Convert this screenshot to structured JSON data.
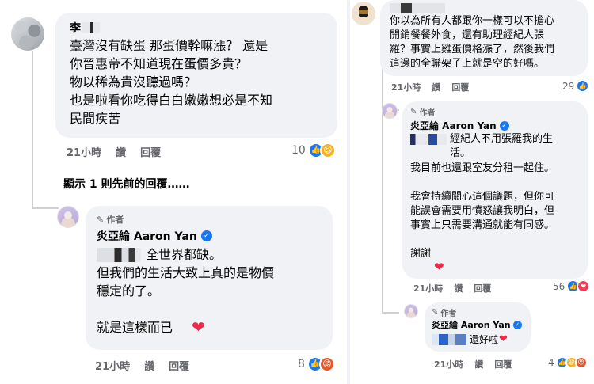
{
  "left": {
    "comment1": {
      "author_initial": "李",
      "text": "臺灣沒有缺蛋 那蛋價幹嘛漲？ 還是\n你晉惠帝不知道現在蛋價多貴？\n物以稀為貴沒聽過嗎？\n也是啦看你吃得白白嫩嫩想必是不知\n民間疾苦",
      "time": "21小時",
      "like": "讚",
      "reply": "回覆",
      "reaction_count": "10"
    },
    "show_previous": "顯示 1 則先前的回覆……",
    "reply1": {
      "author_badge": "作者",
      "author_name": "炎亞綸 Aaron Yan",
      "tagged_tail": "全世界都缺。",
      "text": "但我們的生活大致上真的是物價\n穩定的了。\n\n就是這樣而已",
      "time": "21小時",
      "like": "讚",
      "reply": "回覆",
      "reaction_count": "8"
    }
  },
  "right": {
    "comment1": {
      "text": "你以為所有人都跟你一樣可以不擔心\n開銷餐餐外食，還有助理經紀人張\n羅？事實上雞蛋價格漲了，然後我們\n這邊的全聯架子上就是空的好嗎。",
      "time": "21小時",
      "like": "讚",
      "reply": "回覆",
      "reaction_count": "29"
    },
    "reply1": {
      "author_badge": "作者",
      "author_name": "炎亞綸 Aaron Yan",
      "tagged_tail": "經紀人不用張羅我的生\n活。",
      "text": "我目前也還跟室友分租一起住。\n\n我會持續關心這個議題，但你可\n能誤會需要用憤怒讓我明白，但\n事實上只需要溝通就能有同感。\n\n謝謝",
      "time": "21小時",
      "like": "讚",
      "reply": "回覆",
      "reaction_count": "56"
    },
    "reply2": {
      "author_badge": "作者",
      "author_name": "炎亞綸 Aaron Yan",
      "text": "還好啦",
      "time": "21小時",
      "like": "讚",
      "reply": "回覆",
      "reaction_count": "4"
    }
  },
  "icons": {
    "verified": "verified-check-icon",
    "pen": "pen-icon",
    "heart": "heart-emoji-icon"
  },
  "colors": {
    "bubble": "#f0f2f5",
    "meta": "#65676b",
    "like_blue": "#1877f2",
    "heart_red": "#f02849"
  }
}
